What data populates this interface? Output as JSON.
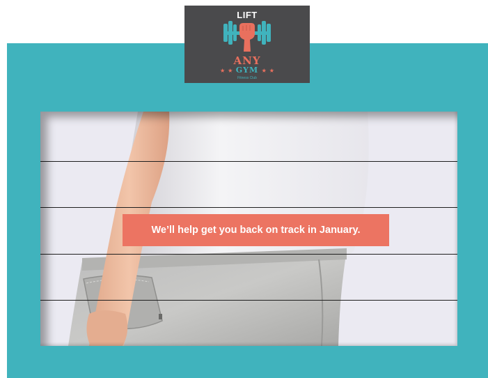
{
  "logo": {
    "top_text": "LIFT",
    "brand_text": "ANY",
    "brand_sub": "GYM",
    "tagline": "Fitness Club",
    "star_glyph": "★",
    "icon": "fist-dumbbell-icon"
  },
  "banner": {
    "text": "We’ll help get you back on track in January."
  },
  "colors": {
    "teal": "#40b3bd",
    "coral": "#ec7462",
    "logo_bg": "#4a4a4c"
  }
}
